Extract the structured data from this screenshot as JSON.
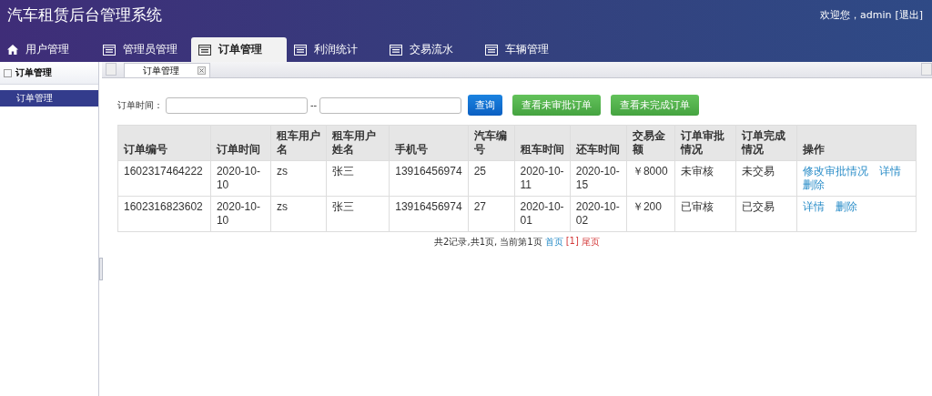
{
  "header": {
    "title": "汽车租赁后台管理系统",
    "welcome": "欢迎您，admin",
    "logout": "[退出]"
  },
  "nav_tabs": [
    {
      "label": "用户管理",
      "kind": "home",
      "selected": false
    },
    {
      "label": "管理员管理",
      "kind": "window",
      "selected": false
    },
    {
      "label": "订单管理",
      "kind": "window",
      "selected": true
    },
    {
      "label": "利润统计",
      "kind": "window",
      "selected": false
    },
    {
      "label": "交易流水",
      "kind": "window",
      "selected": false
    },
    {
      "label": "车辆管理",
      "kind": "window",
      "selected": false
    }
  ],
  "sidebar": {
    "title": "订单管理",
    "items": [
      {
        "label": "订单管理",
        "selected": true
      }
    ]
  },
  "content_tabs": [
    {
      "label": "订单管理",
      "selected": true
    }
  ],
  "filter": {
    "label": "订单时间：",
    "separator": "--",
    "buttons": [
      {
        "label": "查询",
        "kind": "primary"
      },
      {
        "label": "查看未审批订单",
        "kind": "success"
      },
      {
        "label": "查看未完成订单",
        "kind": "success"
      }
    ]
  },
  "table": {
    "columns": [
      "订单编号",
      "订单时间",
      "租车用户名",
      "租车用户姓名",
      "手机号",
      "汽车编号",
      "租车时间",
      "还车时间",
      "交易金额",
      "订单审批情况",
      "订单完成情况",
      "操作"
    ],
    "rows": [
      {
        "cells": [
          "1602317464222",
          "2020-10-10",
          "zs",
          "张三",
          "13916456974",
          "25",
          "2020-10-11",
          "2020-10-15",
          "￥8000",
          "未审核",
          "未交易"
        ],
        "actions": [
          "修改审批情况",
          "详情",
          "删除"
        ]
      },
      {
        "cells": [
          "1602316823602",
          "2020-10-10",
          "zs",
          "张三",
          "13916456974",
          "27",
          "2020-10-01",
          "2020-10-02",
          "￥200",
          "已审核",
          "已交易"
        ],
        "actions": [
          "详情",
          "删除"
        ]
      }
    ]
  },
  "pagination": {
    "summary": "共2记录,共1页, 当前第1页",
    "first": "首页",
    "current": "[1]",
    "last": "尾页"
  }
}
